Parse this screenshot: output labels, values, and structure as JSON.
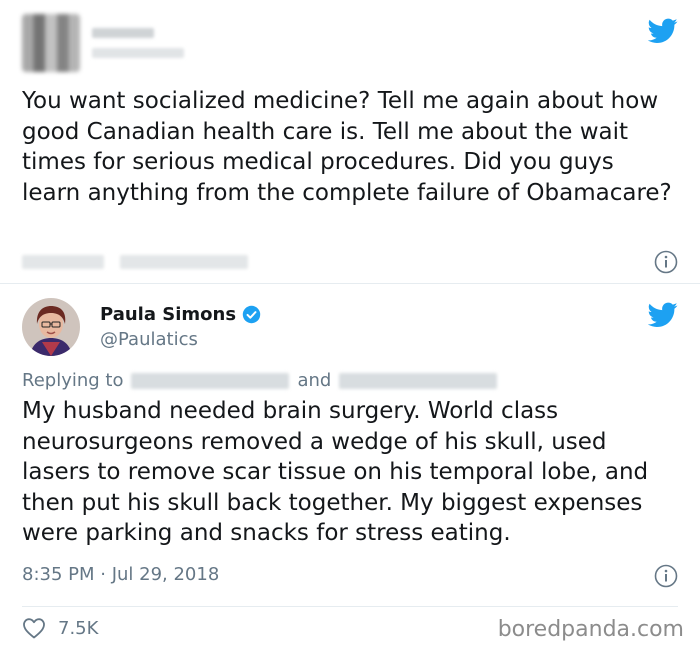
{
  "tweet_original": {
    "text": "You want socialized medicine? Tell me again about how good Canadian health care is. Tell me about the wait times for serious medical procedures. Did you guys learn anything from the complete failure of Obamacare?",
    "author_redacted": true,
    "icons": [
      "twitter-bird-icon",
      "info-icon"
    ]
  },
  "tweet_reply": {
    "display_name": "Paula Simons",
    "handle": "@Paulatics",
    "verified": true,
    "replying_to_label": "Replying to",
    "and_label": "and",
    "text": "My husband needed brain surgery. World class neurosurgeons removed a wedge of his skull, used lasers to remove scar tissue on his temporal lobe, and then put his skull back together. My biggest expenses were parking and snacks for stress eating.",
    "timestamp": "8:35 PM · Jul 29, 2018",
    "like_count": "7.5K",
    "icons": [
      "twitter-bird-icon",
      "verified-icon",
      "info-icon",
      "heart-icon"
    ]
  },
  "watermark": "boredpanda.com",
  "colors": {
    "twitter_blue": "#1da1f2",
    "text": "#14171a",
    "muted": "#657786",
    "border": "#e6ecf0"
  }
}
